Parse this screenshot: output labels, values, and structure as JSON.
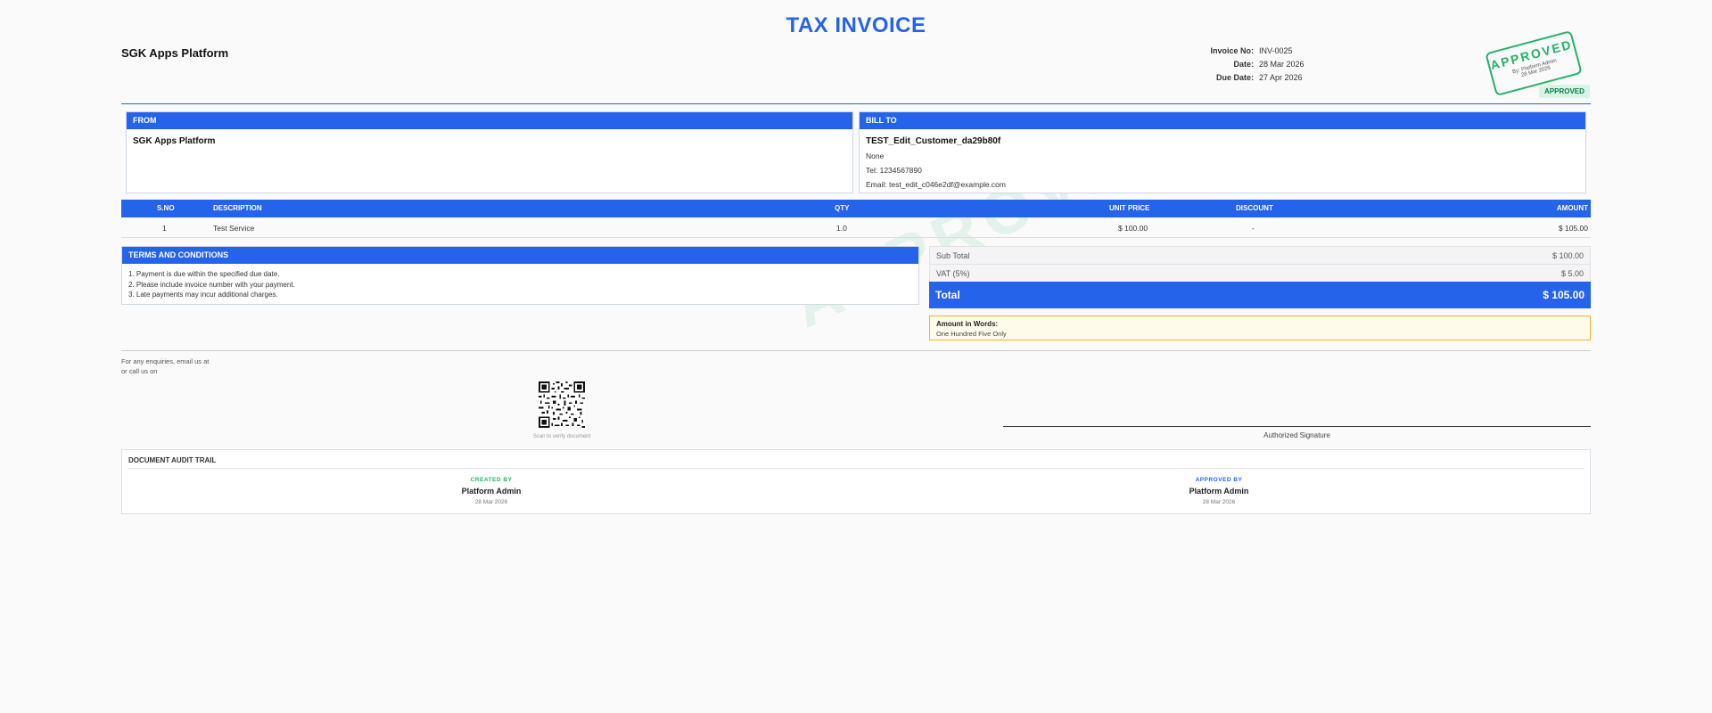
{
  "header": {
    "title": "TAX INVOICE",
    "company": "SGK Apps Platform",
    "meta": [
      {
        "label": "Invoice No:",
        "value": "INV-0025"
      },
      {
        "label": "Date:",
        "value": "28 Mar 2026"
      },
      {
        "label": "Due Date:",
        "value": "27 Apr 2026"
      }
    ],
    "stamp": {
      "text": "APPROVED",
      "by": "By: Platform Admin",
      "date": "28 Mar 2026"
    },
    "status_tag": "APPROVED"
  },
  "from": {
    "heading": "FROM",
    "name": "SGK Apps Platform"
  },
  "bill_to": {
    "heading": "BILL TO",
    "name": "TEST_Edit_Customer_da29b80f",
    "line1": "None",
    "phone": "Tel: 1234567890",
    "email": "Email: test_edit_c046e2df@example.com"
  },
  "items_table": {
    "columns": {
      "sno": "S.NO",
      "description": "DESCRIPTION",
      "qty": "QTY",
      "unit_price": "UNIT PRICE",
      "discount": "DISCOUNT",
      "amount": "AMOUNT"
    },
    "rows": [
      {
        "sno": "1",
        "description": "Test Service",
        "qty": "1.0",
        "unit_price": "$ 100.00",
        "discount": "-",
        "amount": "$ 105.00"
      }
    ]
  },
  "terms": {
    "heading": "TERMS AND CONDITIONS",
    "items": [
      "1. Payment is due within the specified due date.",
      "2. Please include invoice number with your payment.",
      "3. Late payments may incur additional charges."
    ]
  },
  "totals": {
    "subtotal_label": "Sub Total",
    "subtotal_value": "$ 100.00",
    "vat_label": "VAT (5%)",
    "vat_value": "$ 5.00",
    "total_label": "Total",
    "total_value": "$ 105.00"
  },
  "amount_in_words": {
    "label": "Amount in Words:",
    "value": "One Hundred Five Only"
  },
  "contact": {
    "line1": "For any enquiries, email us at",
    "line2": "or call us on"
  },
  "qr_caption": "Scan to verify document",
  "signature_label": "Authorized Signature",
  "watermark": "APPROVED",
  "audit": {
    "heading": "DOCUMENT AUDIT TRAIL",
    "created": {
      "label": "CREATED BY",
      "name": "Platform Admin",
      "date": "28 Mar 2026"
    },
    "approved": {
      "label": "APPROVED BY",
      "name": "Platform Admin",
      "date": "28 Mar 2026"
    }
  },
  "colors": {
    "accent": "#2563eb",
    "approved": "#22b366",
    "warning_border": "#f0b429"
  }
}
